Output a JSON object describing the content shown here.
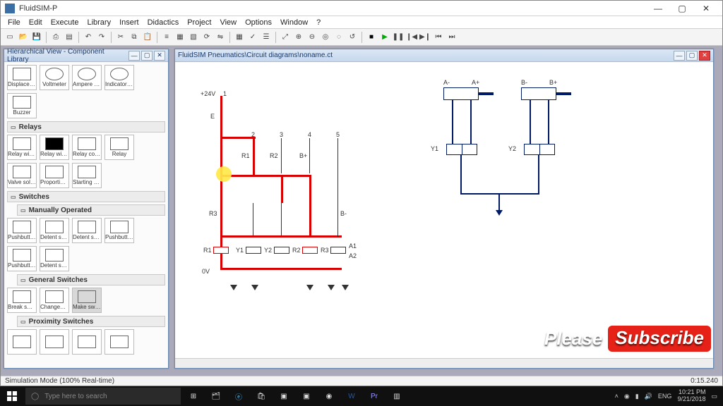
{
  "app": {
    "title": "FluidSIM-P"
  },
  "menu": [
    "File",
    "Edit",
    "Execute",
    "Library",
    "Insert",
    "Didactics",
    "Project",
    "View",
    "Options",
    "Window",
    "?"
  ],
  "library_window": {
    "title": "Hierarchical View - Component Library",
    "row1": [
      "Displaceme…",
      "Voltmeter",
      "Ampere meter",
      "Indicator light"
    ],
    "row2": [
      "Buzzer"
    ],
    "sec_relays": "Relays",
    "row3": [
      "Relay with…",
      "Relay with…",
      "Relay counter",
      "Relay"
    ],
    "row4": [
      "Valve sole…",
      "Proportional…",
      "Starting curr…"
    ],
    "sec_switches": "Switches",
    "sec_manual": "Manually Operated",
    "row5": [
      "Pushbutton…",
      "Detent swit…",
      "Detent swit…",
      "Pushbutton…"
    ],
    "row6": [
      "Pushbutton…",
      "Detent swit…"
    ],
    "sec_general": "General Switches",
    "row7": [
      "Break switch",
      "Changeover…",
      "Make switch"
    ],
    "sec_prox": "Proximity Switches"
  },
  "canvas_window": {
    "title": "FluidSIM Pneumatics\\Circuit diagrams\\noname.ct"
  },
  "circuit": {
    "rail_top": "+24V",
    "rail_bot": "0V",
    "cols": [
      "1",
      "2",
      "3",
      "4",
      "5"
    ],
    "labels": {
      "E": "E",
      "R1": "R1",
      "R2": "R2",
      "R3": "R3",
      "Y1": "Y1",
      "Y2": "Y2",
      "A1": "A1",
      "A2": "A2",
      "Bplus": "B+",
      "Bminus": "B-",
      "Aplus": "A+",
      "Aminus": "A-"
    },
    "pn": {
      "aM": "A-",
      "aP": "A+",
      "bM": "B-",
      "bP": "B+",
      "y1": "Y1",
      "y2": "Y2"
    }
  },
  "status": {
    "left": "Simulation Mode (100% Real-time)",
    "right": "0:15.240"
  },
  "banner": {
    "please": "Please",
    "subscribe": "Subscribe"
  },
  "taskbar": {
    "search_placeholder": "Type here to search",
    "lang": "ENG",
    "time": "10:21 PM",
    "date": "9/21/2018"
  }
}
